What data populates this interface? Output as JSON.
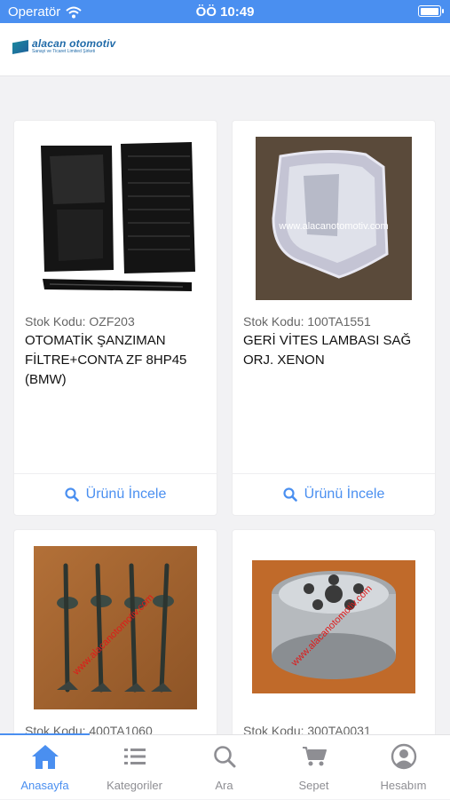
{
  "status_bar": {
    "carrier": "Operatör",
    "time": "ÖÖ 10:49",
    "battery_level": 1.0
  },
  "header": {
    "logo_name": "alacan otomotiv",
    "logo_subtitle": "Sanayi ve Ticaret Limited Şirketi"
  },
  "products": [
    {
      "stok": "Stok Kodu: OZF203",
      "title": "OTOMATİK ŞANZIMAN FİLTRE+CONTA ZF 8HP45 (BMW)",
      "button": "Ürünü İncele"
    },
    {
      "stok": "Stok Kodu: 100TA1551",
      "title": "GERİ VİTES LAMBASI SAĞ ORJ. XENON",
      "button": "Ürünü İncele",
      "watermark": "www.alacanotomotiv.com"
    },
    {
      "stok": "Stok Kodu: 400TA1060",
      "watermark": "www.alacanotomotiv.com"
    },
    {
      "stok": "Stok Kodu: 300TA0031",
      "watermark": "www.alacanotomotiv.com"
    }
  ],
  "tabbar": {
    "items": [
      {
        "label": "Anasayfa",
        "icon": "home-icon",
        "active": true
      },
      {
        "label": "Kategoriler",
        "icon": "list-icon"
      },
      {
        "label": "Ara",
        "icon": "search-icon"
      },
      {
        "label": "Sepet",
        "icon": "cart-icon"
      },
      {
        "label": "Hesabım",
        "icon": "account-icon"
      }
    ]
  },
  "colors": {
    "accent": "#4a8ff0",
    "inactive": "#8e8e93",
    "logo": "#1f6aa8"
  }
}
